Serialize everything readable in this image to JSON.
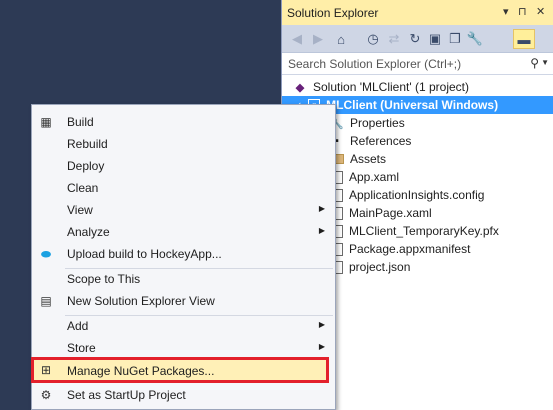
{
  "solution_explorer": {
    "title": "Solution Explorer",
    "title_buttons": [
      "▾",
      "⊓",
      "✕"
    ],
    "search_placeholder": "Search Solution Explorer (Ctrl+;)",
    "tree": [
      {
        "label": "Solution 'MLClient' (1 project)",
        "icon": "solution-icon"
      },
      {
        "label": "MLClient (Universal Windows)",
        "icon": "project-icon",
        "selected": true
      },
      {
        "label": "Properties",
        "icon": "wrench-icon"
      },
      {
        "label": "References",
        "icon": "references-icon"
      },
      {
        "label": "Assets",
        "icon": "folder-icon"
      },
      {
        "label": "App.xaml",
        "icon": "file-icon"
      },
      {
        "label": "ApplicationInsights.config",
        "icon": "file-icon"
      },
      {
        "label": "MainPage.xaml",
        "icon": "file-icon"
      },
      {
        "label": "MLClient_TemporaryKey.pfx",
        "icon": "file-icon"
      },
      {
        "label": "Package.appxmanifest",
        "icon": "file-icon"
      },
      {
        "label": "project.json",
        "icon": "file-icon"
      }
    ]
  },
  "context_menu": {
    "items": [
      {
        "label": "Build",
        "icon": "build-icon"
      },
      {
        "label": "Rebuild"
      },
      {
        "label": "Deploy"
      },
      {
        "label": "Clean"
      },
      {
        "label": "View",
        "submenu": true
      },
      {
        "label": "Analyze",
        "submenu": true
      },
      {
        "label": "Upload build to HockeyApp...",
        "icon": "hockeyapp-icon"
      },
      {
        "label": "Scope to This"
      },
      {
        "label": "New Solution Explorer View",
        "icon": "new-view-icon"
      },
      {
        "label": "Add",
        "submenu": true
      },
      {
        "label": "Store",
        "submenu": true
      },
      {
        "label": "Manage NuGet Packages...",
        "icon": "nuget-icon",
        "highlighted": true
      },
      {
        "label": "Set as StartUp Project",
        "icon": "gear-icon"
      }
    ]
  },
  "colors": {
    "selection": "#3399ff",
    "highlight_border": "#e3202b",
    "title_bar": "#ffeea8",
    "background": "#2d3a55"
  }
}
